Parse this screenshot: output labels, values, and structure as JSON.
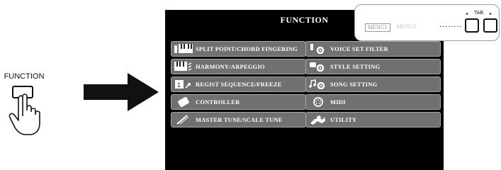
{
  "panel": {
    "function_label": "FUNCTION"
  },
  "screen": {
    "title": "FUNCTION",
    "menu_tabs": [
      {
        "label": "MENU1",
        "active": true
      },
      {
        "label": "MENU2",
        "active": false
      }
    ],
    "left_items": [
      {
        "label": "SPLIT POINT/CHORD FINGERING",
        "icon": "keyboard-split-icon"
      },
      {
        "label": "HARMONY/ARPEGGIO",
        "icon": "keyboard-harmony-icon"
      },
      {
        "label": "REGIST SEQUENCE/FREEZE",
        "icon": "registration-icon"
      },
      {
        "label": "CONTROLLER",
        "icon": "controller-icon"
      },
      {
        "label": "MASTER TUNE/SCALE TUNE",
        "icon": "tuning-icon"
      }
    ],
    "right_items": [
      {
        "label": "VOICE SET FILTER",
        "icon": "voice-set-gear-icon"
      },
      {
        "label": "STYLE SETTING",
        "icon": "style-gear-icon"
      },
      {
        "label": "SONG SETTING",
        "icon": "song-gear-icon"
      },
      {
        "label": "MIDI",
        "icon": "midi-icon"
      },
      {
        "label": "UTILITY",
        "icon": "utility-wrench-icon"
      }
    ]
  },
  "callout": {
    "tab_label": "TAB",
    "tab_left_arrow": "◂",
    "tab_right_arrow": "▸",
    "dots": "........"
  },
  "colors": {
    "screen_bg": "#000000",
    "item_bg": "#707070",
    "item_border": "#a8a8a8",
    "text": "#ffffff"
  }
}
